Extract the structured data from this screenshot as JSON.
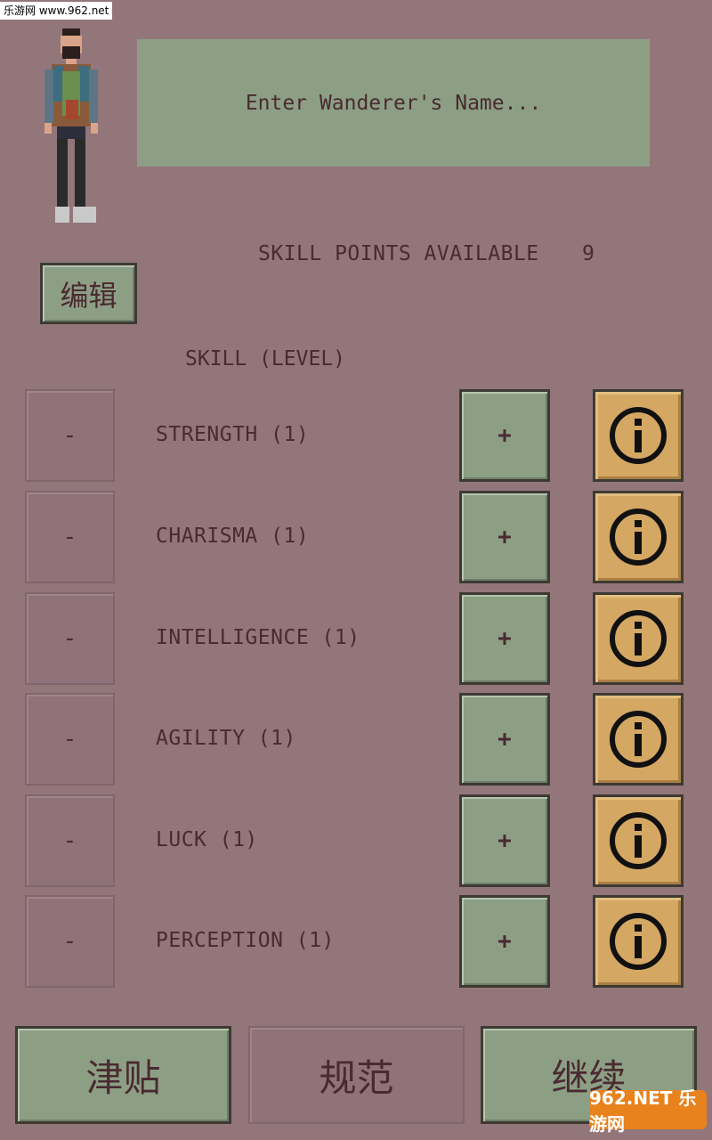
{
  "watermark": "乐游网 www.962.net",
  "name_field": {
    "placeholder": "Enter Wanderer's Name...",
    "value": ""
  },
  "skill_points": {
    "label": "SKILL POINTS AVAILABLE",
    "value": "9"
  },
  "edit_button": "编辑",
  "skill_header": "SKILL (LEVEL)",
  "skills": [
    {
      "name": "STRENGTH (1)",
      "minus": "-",
      "plus": "+"
    },
    {
      "name": "CHARISMA (1)",
      "minus": "-",
      "plus": "+"
    },
    {
      "name": "INTELLIGENCE (1)",
      "minus": "-",
      "plus": "+"
    },
    {
      "name": "AGILITY (1)",
      "minus": "-",
      "plus": "+"
    },
    {
      "name": "LUCK (1)",
      "minus": "-",
      "plus": "+"
    },
    {
      "name": "PERCEPTION (1)",
      "minus": "-",
      "plus": "+"
    }
  ],
  "bottom_buttons": {
    "left": "津贴",
    "middle": "规范",
    "right": "继续"
  },
  "logo": "962.NET 乐游网",
  "colors": {
    "background": "#93767a",
    "panel_green": "#8c9f85",
    "info_orange": "#d4a763",
    "text": "#4a2a30"
  },
  "icons": {
    "info": "info-circle-icon",
    "character": "wanderer-sprite"
  }
}
